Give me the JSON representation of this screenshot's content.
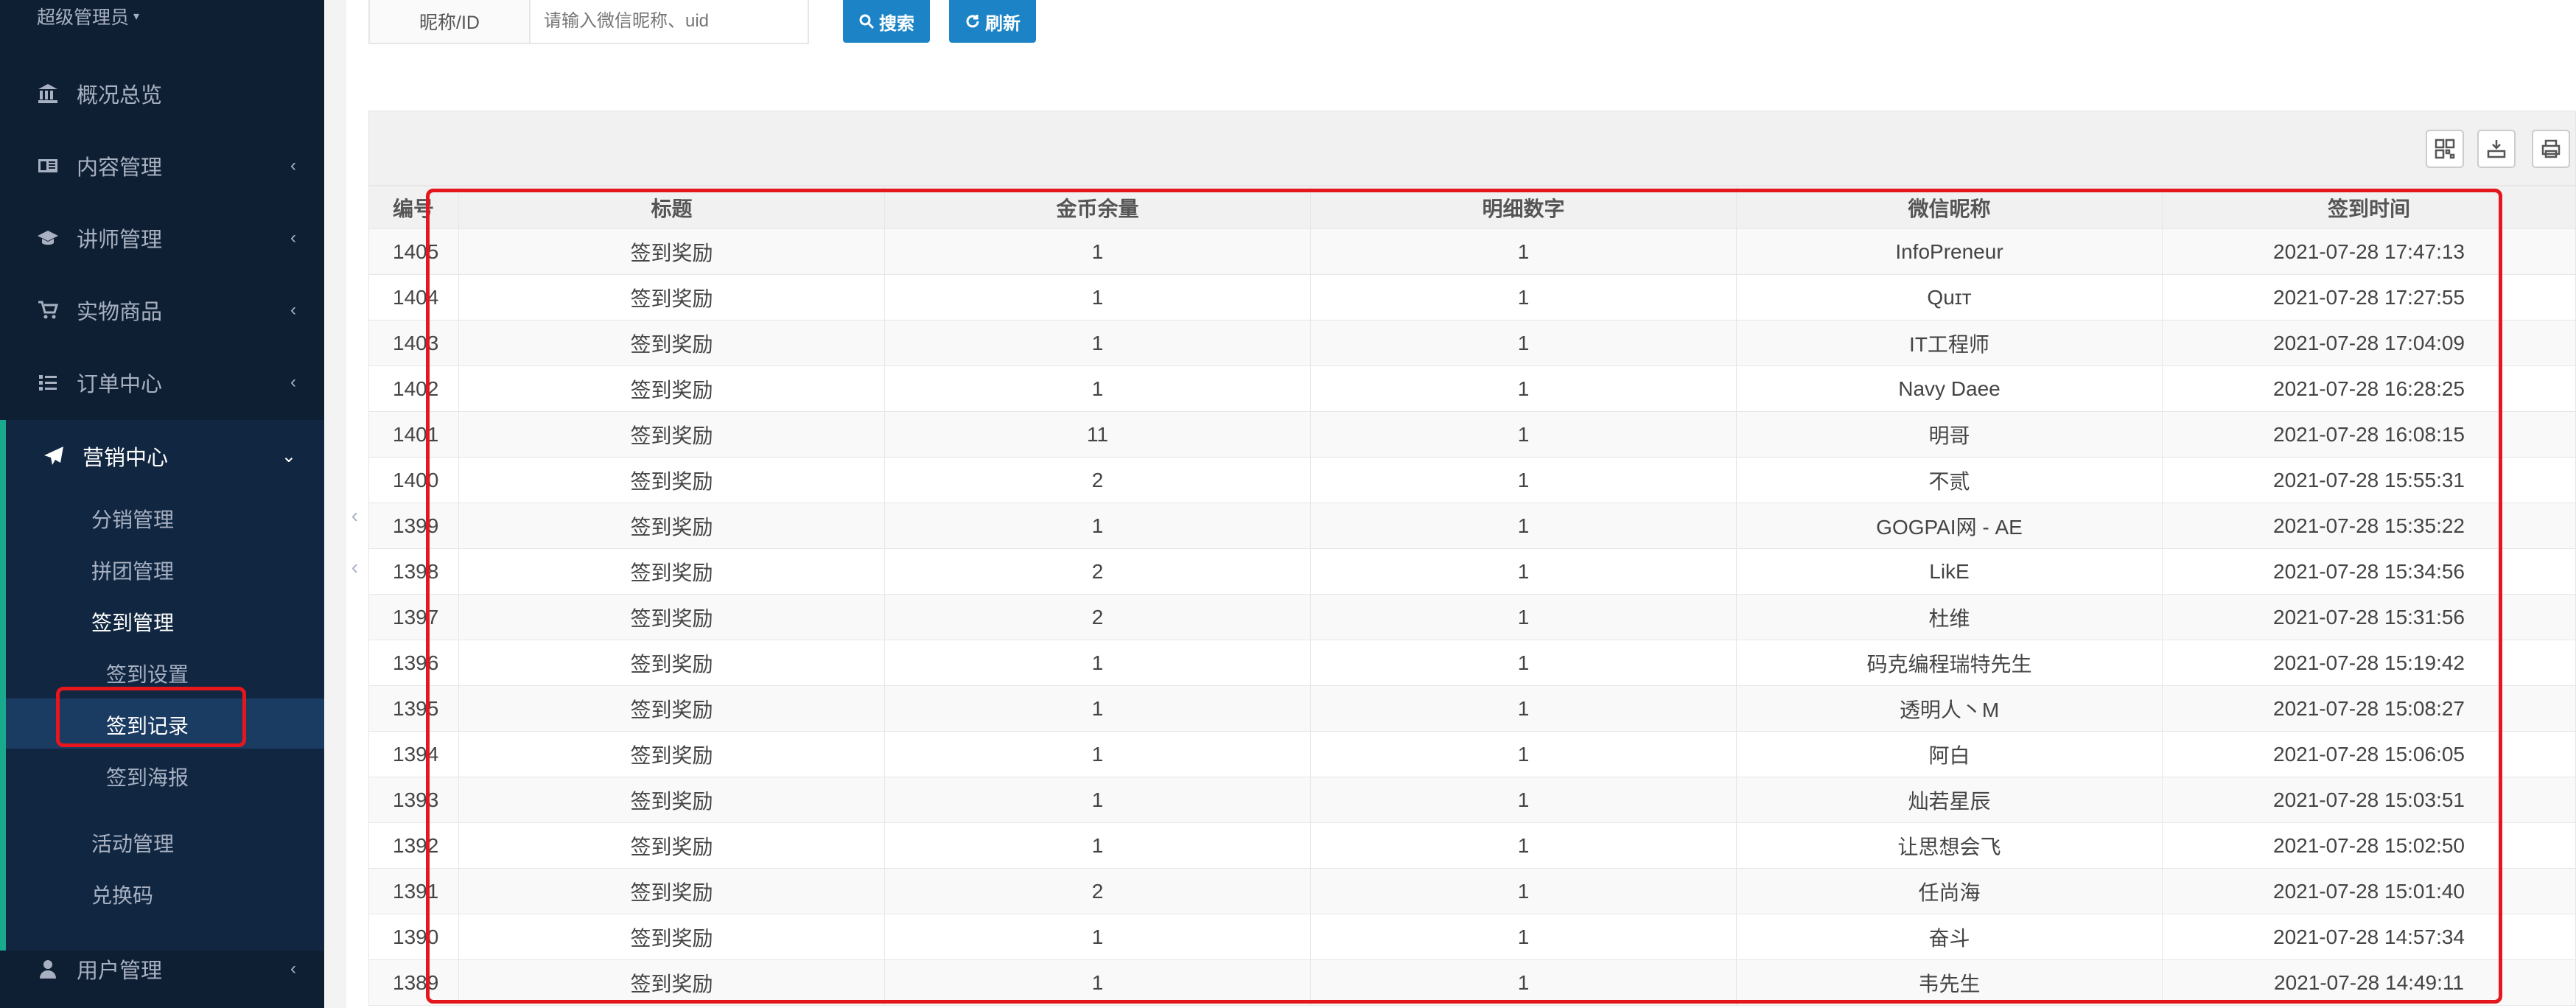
{
  "sidebar": {
    "role": "超级管理员",
    "menu": [
      {
        "label": "概况总览",
        "icon": "bank-icon",
        "has_arrow": false
      },
      {
        "label": "内容管理",
        "icon": "newspaper-icon",
        "has_arrow": true
      },
      {
        "label": "讲师管理",
        "icon": "graduation-cap-icon",
        "has_arrow": true
      },
      {
        "label": "实物商品",
        "icon": "cart-icon",
        "has_arrow": true
      },
      {
        "label": "订单中心",
        "icon": "list-icon",
        "has_arrow": true
      },
      {
        "label": "营销中心",
        "icon": "paper-plane-icon",
        "has_arrow": true
      },
      {
        "label": "用户管理",
        "icon": "user-icon",
        "has_arrow": true
      }
    ],
    "marketing_sub": [
      {
        "label": "分销管理",
        "arrow": "‹"
      },
      {
        "label": "拼团管理",
        "arrow": "‹"
      },
      {
        "label": "签到管理",
        "arrow": "⌄"
      },
      {
        "label": "活动管理",
        "arrow": ""
      },
      {
        "label": "兑换码",
        "arrow": ""
      }
    ],
    "signin_sub": [
      "签到设置",
      "签到记录",
      "签到海报"
    ]
  },
  "search": {
    "label": "昵称/ID",
    "placeholder": "请输入微信昵称、uid",
    "search_button": "搜索",
    "refresh_button": "刷新"
  },
  "table": {
    "headers": [
      "编号",
      "标题",
      "金币余量",
      "明细数字",
      "微信昵称",
      "签到时间"
    ],
    "rows": [
      [
        "1405",
        "签到奖励",
        "1",
        "1",
        "InfoPreneur",
        "2021-07-28 17:47:13"
      ],
      [
        "1404",
        "签到奖励",
        "1",
        "1",
        "Quɪт",
        "2021-07-28 17:27:55"
      ],
      [
        "1403",
        "签到奖励",
        "1",
        "1",
        "IT工程师",
        "2021-07-28 17:04:09"
      ],
      [
        "1402",
        "签到奖励",
        "1",
        "1",
        "Navy Daee",
        "2021-07-28 16:28:25"
      ],
      [
        "1401",
        "签到奖励",
        "11",
        "1",
        "明哥",
        "2021-07-28 16:08:15"
      ],
      [
        "1400",
        "签到奖励",
        "2",
        "1",
        "不贰",
        "2021-07-28 15:55:31"
      ],
      [
        "1399",
        "签到奖励",
        "1",
        "1",
        "GOGPAI网 - AE",
        "2021-07-28 15:35:22"
      ],
      [
        "1398",
        "签到奖励",
        "2",
        "1",
        "LikE",
        "2021-07-28 15:34:56"
      ],
      [
        "1397",
        "签到奖励",
        "2",
        "1",
        "杜维",
        "2021-07-28 15:31:56"
      ],
      [
        "1396",
        "签到奖励",
        "1",
        "1",
        "码克编程瑞特先生",
        "2021-07-28 15:19:42"
      ],
      [
        "1395",
        "签到奖励",
        "1",
        "1",
        "透明人丶M",
        "2021-07-28 15:08:27"
      ],
      [
        "1394",
        "签到奖励",
        "1",
        "1",
        "阿白",
        "2021-07-28 15:06:05"
      ],
      [
        "1393",
        "签到奖励",
        "1",
        "1",
        "灿若星辰",
        "2021-07-28 15:03:51"
      ],
      [
        "1392",
        "签到奖励",
        "1",
        "1",
        "让思想会飞",
        "2021-07-28 15:02:50"
      ],
      [
        "1391",
        "签到奖励",
        "2",
        "1",
        "任尚海",
        "2021-07-28 15:01:40"
      ],
      [
        "1390",
        "签到奖励",
        "1",
        "1",
        "奋斗",
        "2021-07-28 14:57:34"
      ],
      [
        "1389",
        "签到奖励",
        "1",
        "1",
        "韦先生",
        "2021-07-28 14:49:11"
      ]
    ]
  },
  "toolbar_icons": [
    "columns-icon",
    "export-icon",
    "print-icon"
  ],
  "colors": {
    "sidebar": "#0f1f33",
    "accent": "#1c84c6",
    "highlight": "#e5171d"
  }
}
